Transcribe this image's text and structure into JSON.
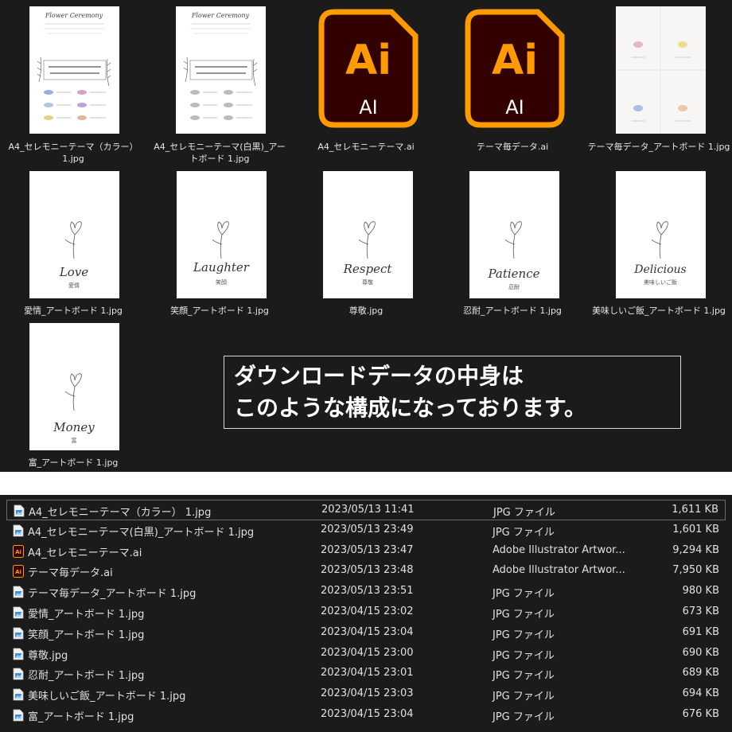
{
  "grid": {
    "items": [
      {
        "name": "A4_セレモニーテーマ（カラー） 1.jpg",
        "kind": "jpg-ceremony-color"
      },
      {
        "name": "A4_セレモニーテーマ(白黒)_アートボード 1.jpg",
        "kind": "jpg-ceremony-mono"
      },
      {
        "name": "A4_セレモニーテーマ.ai",
        "kind": "ai",
        "icon_text": "Ai",
        "icon_sub": "AI"
      },
      {
        "name": "テーマ毎データ.ai",
        "kind": "ai",
        "icon_text": "Ai",
        "icon_sub": "AI"
      },
      {
        "name": "テーマ毎データ_アートボード 1.jpg",
        "kind": "jpg-theme-board"
      },
      {
        "name": "愛情_アートボード 1.jpg",
        "kind": "jpg-card",
        "word": "Love",
        "jp": "愛情"
      },
      {
        "name": "笑顔_アートボード 1.jpg",
        "kind": "jpg-card",
        "word": "Laughter",
        "jp": "笑顔"
      },
      {
        "name": "尊敬.jpg",
        "kind": "jpg-card",
        "word": "Respect",
        "jp": "尊敬"
      },
      {
        "name": "忍耐_アートボード 1.jpg",
        "kind": "jpg-card",
        "word": "Patience",
        "jp": "忍耐"
      },
      {
        "name": "美味しいご飯_アートボード 1.jpg",
        "kind": "jpg-card",
        "word": "Delicious",
        "jp": "美味しいご飯"
      },
      {
        "name": "富_アートボード 1.jpg",
        "kind": "jpg-card",
        "word": "Money",
        "jp": "富"
      }
    ],
    "ceremony_title": "Flower Ceremony"
  },
  "callout": {
    "line1": "ダウンロードデータの中身は",
    "line2": "このような構成になっております。"
  },
  "details": {
    "rows": [
      {
        "name": "A4_セレモニーテーマ（カラー） 1.jpg",
        "date": "2023/05/13 11:41",
        "type": "JPG ファイル",
        "size": "1,611 KB",
        "icon": "jpg-file-icon",
        "selected": true
      },
      {
        "name": "A4_セレモニーテーマ(白黒)_アートボード 1.jpg",
        "date": "2023/05/13 23:49",
        "type": "JPG ファイル",
        "size": "1,601 KB",
        "icon": "jpg-file-icon"
      },
      {
        "name": "A4_セレモニーテーマ.ai",
        "date": "2023/05/13 23:47",
        "type": "Adobe Illustrator Artwor...",
        "size": "9,294 KB",
        "icon": "ai-file-icon"
      },
      {
        "name": "テーマ毎データ.ai",
        "date": "2023/05/13 23:48",
        "type": "Adobe Illustrator Artwor...",
        "size": "7,950 KB",
        "icon": "ai-file-icon"
      },
      {
        "name": "テーマ毎データ_アートボード 1.jpg",
        "date": "2023/05/13 23:51",
        "type": "JPG ファイル",
        "size": "980 KB",
        "icon": "jpg-file-icon"
      },
      {
        "name": "愛情_アートボード 1.jpg",
        "date": "2023/04/15 23:02",
        "type": "JPG ファイル",
        "size": "673 KB",
        "icon": "jpg-file-icon"
      },
      {
        "name": "笑顔_アートボード 1.jpg",
        "date": "2023/04/15 23:04",
        "type": "JPG ファイル",
        "size": "691 KB",
        "icon": "jpg-file-icon"
      },
      {
        "name": "尊敬.jpg",
        "date": "2023/04/15 23:00",
        "type": "JPG ファイル",
        "size": "690 KB",
        "icon": "jpg-file-icon"
      },
      {
        "name": "忍耐_アートボード 1.jpg",
        "date": "2023/04/15 23:01",
        "type": "JPG ファイル",
        "size": "689 KB",
        "icon": "jpg-file-icon"
      },
      {
        "name": "美味しいご飯_アートボード 1.jpg",
        "date": "2023/04/15 23:03",
        "type": "JPG ファイル",
        "size": "694 KB",
        "icon": "jpg-file-icon"
      },
      {
        "name": "富_アートボード 1.jpg",
        "date": "2023/04/15 23:04",
        "type": "JPG ファイル",
        "size": "676 KB",
        "icon": "jpg-file-icon"
      }
    ]
  },
  "colors": {
    "background": "#1b1b1b",
    "ai_orange": "#ff9a00",
    "ai_dark": "#330000",
    "jpg_blue": "#3b8fd9"
  }
}
